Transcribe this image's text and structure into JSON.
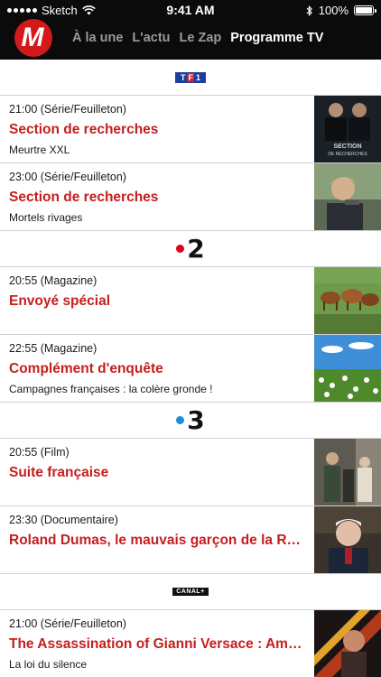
{
  "status": {
    "carrier": "Sketch",
    "time": "9:41 AM",
    "battery": "100%"
  },
  "header": {
    "logo": "M",
    "tabs": [
      {
        "label": "À la une",
        "active": false
      },
      {
        "label": "L'actu",
        "active": false
      },
      {
        "label": "Le Zap",
        "active": false
      },
      {
        "label": "Programme TV",
        "active": true
      }
    ]
  },
  "colors": {
    "accent": "#c51e1e",
    "header_bg": "#0b0b0b",
    "logo_red": "#d21a1a"
  },
  "channels": [
    {
      "name": "TF1",
      "programs": [
        {
          "meta": "21:00 (Série/Feuilleton)",
          "title": "Section de recherches",
          "subtitle": "Meurtre XXL",
          "thumb_name": "section-de-recherches-poster"
        },
        {
          "meta": "23:00 (Série/Feuilleton)",
          "title": "Section de recherches",
          "subtitle": "Mortels rivages",
          "thumb_name": "man-with-gun-photo"
        }
      ]
    },
    {
      "name": "France 2",
      "logo_num": "2",
      "programs": [
        {
          "meta": "20:55 (Magazine)",
          "title": "Envoyé spécial",
          "subtitle": "",
          "thumb_name": "cows-in-field-photo"
        },
        {
          "meta": "22:55 (Magazine)",
          "title": "Complément d'enquête",
          "subtitle": "Campagnes françaises : la colère gronde !",
          "thumb_name": "daisy-field-photo"
        }
      ]
    },
    {
      "name": "France 3",
      "logo_num": "3",
      "programs": [
        {
          "meta": "20:55 (Film)",
          "title": "Suite française",
          "subtitle": "",
          "thumb_name": "film-still-photo"
        },
        {
          "meta": "23:30 (Documentaire)",
          "title": "Roland Dumas, le mauvais garçon de la République",
          "subtitle": "",
          "thumb_name": "older-man-portrait"
        }
      ]
    },
    {
      "name": "CANAL+",
      "programs": [
        {
          "meta": "21:00 (Série/Feuilleton)",
          "title": "The Assassination of Gianni Versace : American Crime Story",
          "subtitle": "La loi du silence",
          "thumb_name": "versace-poster"
        }
      ]
    }
  ]
}
